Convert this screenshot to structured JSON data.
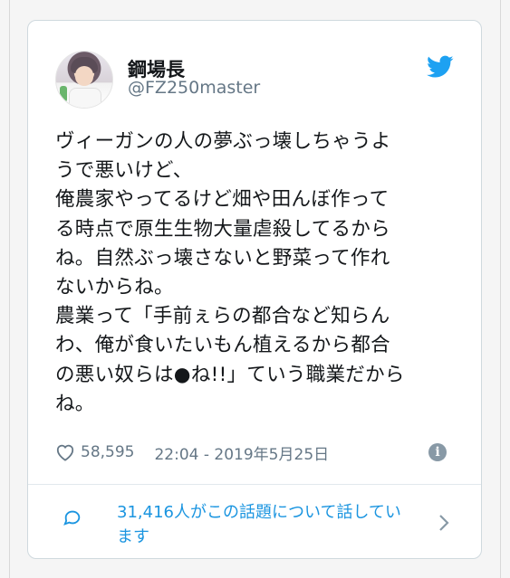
{
  "tweet": {
    "display_name": "鋼場長",
    "handle": "@FZ250master",
    "text_lines": [
      "ヴィーガンの人の夢ぶっ壊しちゃうよ",
      "うで悪いけど、",
      "俺農家やってるけど畑や田んぼ作って",
      "る時点で原生生物大量虐殺してるから",
      "ね。自然ぶっ壊さないと野菜って作れ",
      "ないからね。",
      "農業って「手前ぇらの都合など知らん",
      "わ、俺が食いたいもん植えるから都合",
      "の悪い奴らは●ね!!」ていう職業だから",
      "ね。"
    ],
    "likes": "58,595",
    "timestamp": "22:04 - 2019年5月25日",
    "conversation_line1": "31,416人がこの話題について話してい",
    "conversation_line2": "ます"
  },
  "icons": {
    "avatar": "profile-photo",
    "brand": "twitter-bird-icon",
    "like": "heart-outline-icon",
    "info": "info-icon",
    "conversation": "speech-bubble-icon",
    "chevron": "chevron-right-icon"
  },
  "colors": {
    "twitter_blue": "#1da1f2",
    "link_blue": "#1b95e0",
    "secondary_text": "#657786",
    "primary_text": "#14171a"
  }
}
